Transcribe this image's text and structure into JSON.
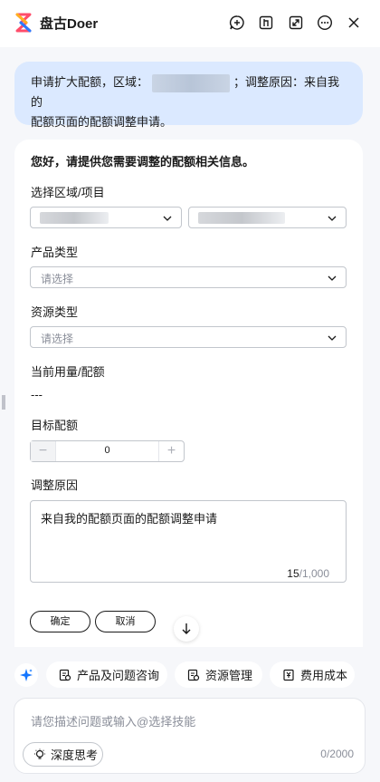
{
  "header": {
    "title": "盘古Doer",
    "icons": [
      "new-chat-icon",
      "pin-icon",
      "expand-icon",
      "more-icon",
      "close-icon"
    ]
  },
  "user_message": {
    "prefix": "申请扩大配额，区域：",
    "suffix_line1": "；调整原因：来自我的",
    "line2": "配额页面的配额调整申请。"
  },
  "form": {
    "greeting": "您好，请提供您需要调整的配额相关信息。",
    "region_label": "选择区域/项目",
    "product_label": "产品类型",
    "product_placeholder": "请选择",
    "resource_label": "资源类型",
    "resource_placeholder": "请选择",
    "usage_label": "当前用量/配额",
    "usage_value": "---",
    "target_label": "目标配额",
    "target_value": "0",
    "stepper_minus": "−",
    "stepper_plus": "+",
    "reason_label": "调整原因",
    "reason_value": "来自我的配额页面的配额调整申请",
    "reason_count_current": "15",
    "reason_count_max": "/1,000",
    "confirm_label": "确定",
    "cancel_label": "取消"
  },
  "quick_actions": [
    {
      "label": "产品及问题咨询",
      "icon": "product-consult-icon"
    },
    {
      "label": "资源管理",
      "icon": "resource-manage-icon"
    },
    {
      "label": "费用成本",
      "icon": "cost-icon"
    }
  ],
  "input": {
    "placeholder": "请您描述问题或输入@选择技能",
    "think_label": "深度思考",
    "char_count": "0/2000"
  },
  "colors": {
    "accent": "#1476ff",
    "bubble": "#dbe9ff",
    "background": "#f6f7fa"
  }
}
